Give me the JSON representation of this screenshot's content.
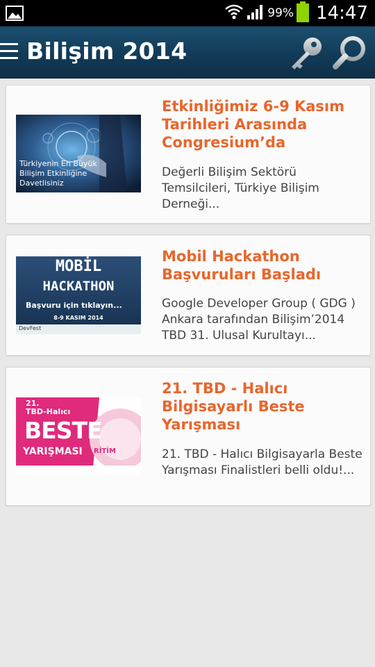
{
  "status_bar": {
    "battery_percent": "99%",
    "time": "14:47"
  },
  "header": {
    "title": "Bilişim 2014"
  },
  "articles": [
    {
      "title": "Etkinliğimiz 6-9 Kasım Tarihleri Arasında Congresium’da",
      "summary": "Değerli Bilişim Sektörü Temsilcileri, Türkiye Bilişim Derneği...",
      "thumb_caption": "Türkiyenin En Büyük Bilişim Etkinliğine Davetlisiniz"
    },
    {
      "title": "Mobil Hackathon Başvuruları Başladı",
      "summary": "Google Developer Group ( GDG ) Ankara tarafından Bilişim’2014 TBD 31. Ulusal Kurultayı...",
      "thumb_line1": "MOBİL",
      "thumb_line2": "HACKATHON",
      "thumb_cta": "Başvuru için tıklayın...",
      "thumb_date": "8-9 KASIM 2014",
      "thumb_sponsor": "DevFest"
    },
    {
      "title": "21. TBD - Halıcı Bilgisayarlı Beste Yarışması",
      "summary": "21. TBD - Halıcı Bilgisayarla Beste Yarışması Finalistleri belli oldu!...",
      "thumb_line1": "21.",
      "thumb_line2": "TBD-Halıcı",
      "thumb_line3": "BESTE",
      "thumb_line4": "YARIŞMASI",
      "thumb_badge": "RİTİM"
    }
  ],
  "colors": {
    "accent": "#e8662c",
    "header_bg": "#123b58",
    "page_bg": "#e8e8e8"
  }
}
